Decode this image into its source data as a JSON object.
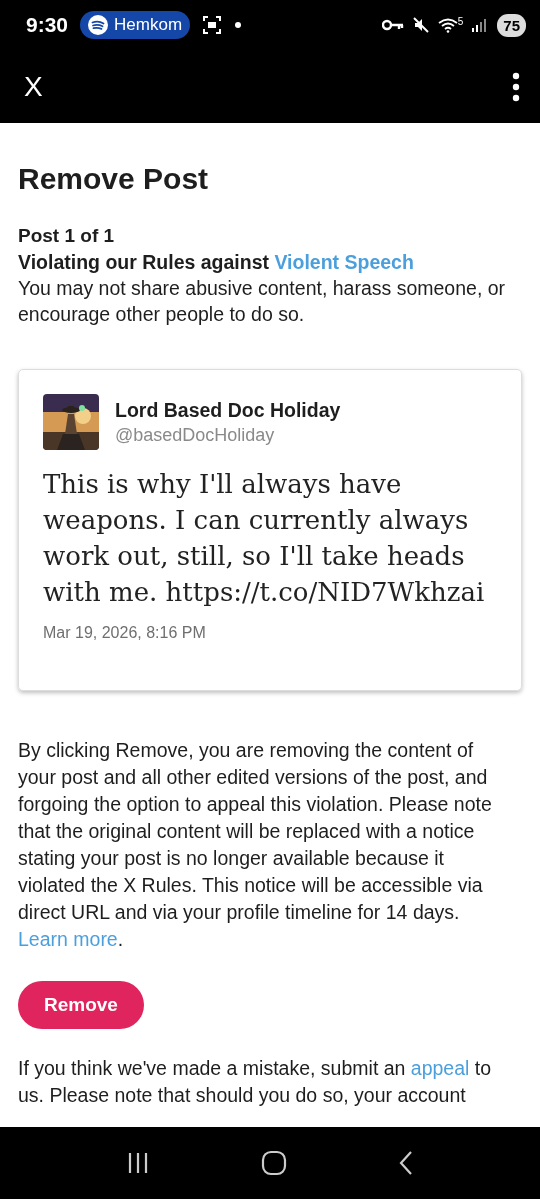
{
  "status_bar": {
    "time": "9:30",
    "media_pill": "Hemkom",
    "wifi_band": "5",
    "battery": "75"
  },
  "app_bar": {
    "title": "X"
  },
  "title": "Remove Post",
  "post_count": "Post 1 of 1",
  "violation": [
    {
      "kind": "bold",
      "text": "Violating our Rules against "
    },
    {
      "kind": "link",
      "text": "Violent Speech"
    }
  ],
  "violation_desc": "You may not share abusive content, harass someone, or encourage other people to do so.",
  "post": {
    "name": "Lord Based Doc Holiday",
    "handle": "@basedDocHoliday",
    "text": "This is why I'll always have weapons. I can currently always work out, still, so I'll take heads with me. https://t.co/NID7Wkhzai",
    "date": "Mar 19, 2026, 8:16 PM"
  },
  "notice": [
    {
      "kind": "plain",
      "text": "By clicking Remove, you are removing the content of your post and all other edited versions of the post, and forgoing the option to appeal this violation. Please note that the original content will be replaced with a notice stating your post is no longer available because it violated the X Rules. This notice will be accessible via direct URL and via your profile timeline for 14 days. "
    },
    {
      "kind": "link",
      "text": "Learn more"
    },
    {
      "kind": "plain",
      "text": "."
    }
  ],
  "remove_button": "Remove",
  "appeal": [
    {
      "kind": "plain",
      "text": "If you think we've made a mistake, submit an "
    },
    {
      "kind": "link",
      "text": "appeal"
    },
    {
      "kind": "plain",
      "text": " to us. Please note that should you do so, your account"
    }
  ]
}
